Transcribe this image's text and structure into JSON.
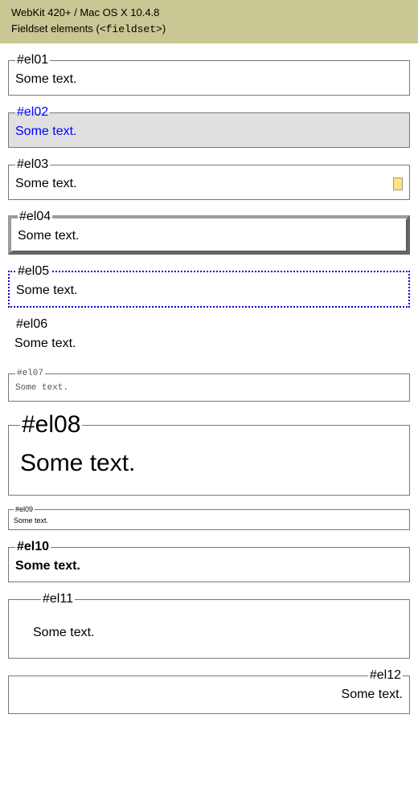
{
  "header": {
    "line1": "WebKit 420+ / Mac OS X 10.4.8",
    "line2_prefix": "Fieldset elements (",
    "line2_code": "<fieldset>",
    "line2_suffix": ")"
  },
  "fieldsets": {
    "el01": {
      "legend": "#el01",
      "text": "Some text."
    },
    "el02": {
      "legend": "#el02",
      "text": "Some text."
    },
    "el03": {
      "legend": "#el03",
      "text": "Some text."
    },
    "el04": {
      "legend": "#el04",
      "text": "Some text."
    },
    "el05": {
      "legend": "#el05",
      "text": "Some text."
    },
    "el06": {
      "legend": "#el06",
      "text": "Some text."
    },
    "el07": {
      "legend": "#el07",
      "text": "Some text."
    },
    "el08": {
      "legend": "#el08",
      "text": "Some text."
    },
    "el09": {
      "legend": "#el09",
      "text": "Some text."
    },
    "el10": {
      "legend": "#el10",
      "text": "Some text."
    },
    "el11": {
      "legend": "#el11",
      "text": "Some text."
    },
    "el12": {
      "legend": "#el12",
      "text": "Some text."
    }
  }
}
